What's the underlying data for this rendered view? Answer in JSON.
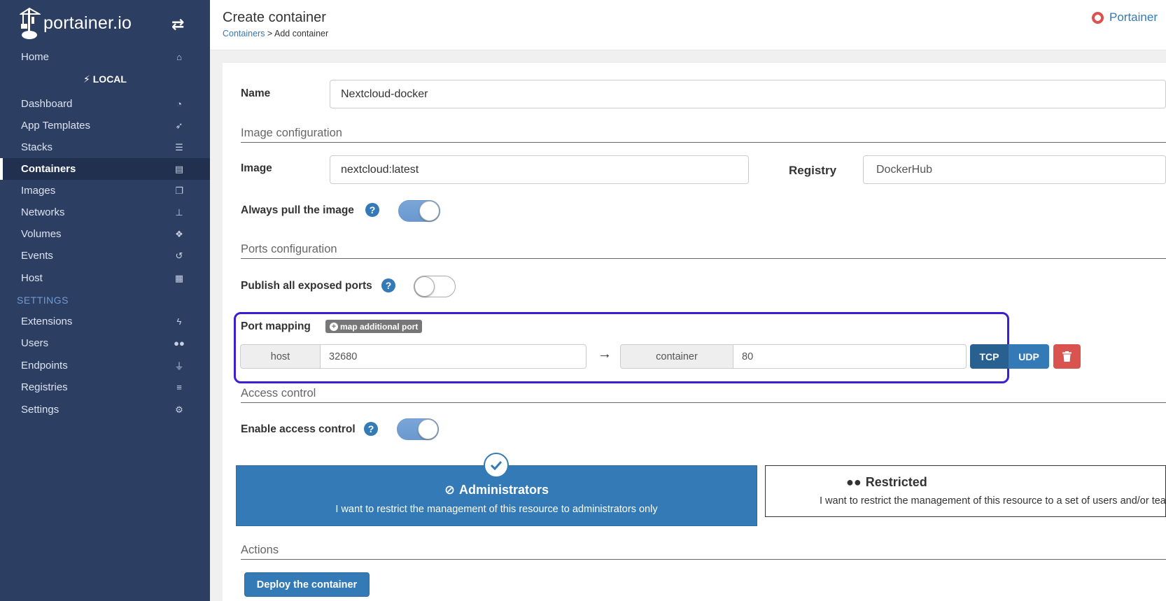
{
  "sidebar": {
    "logo_text": "portainer.io",
    "toggle_icon": "exchange-arrows-icon",
    "home": {
      "label": "Home",
      "icon": "home-icon"
    },
    "endpoint_label": "LOCAL",
    "items": [
      {
        "label": "Dashboard",
        "icon": "tachometer-icon"
      },
      {
        "label": "App Templates",
        "icon": "rocket-icon"
      },
      {
        "label": "Stacks",
        "icon": "th-list-icon"
      },
      {
        "label": "Containers",
        "icon": "server-icon",
        "active": true
      },
      {
        "label": "Images",
        "icon": "clone-icon"
      },
      {
        "label": "Networks",
        "icon": "sitemap-icon"
      },
      {
        "label": "Volumes",
        "icon": "cubes-icon"
      },
      {
        "label": "Events",
        "icon": "history-icon"
      },
      {
        "label": "Host",
        "icon": "th-icon"
      }
    ],
    "settings_heading": "SETTINGS",
    "settings_items": [
      {
        "label": "Extensions",
        "icon": "bolt-icon"
      },
      {
        "label": "Users",
        "icon": "users-icon"
      },
      {
        "label": "Endpoints",
        "icon": "plug-icon"
      },
      {
        "label": "Registries",
        "icon": "database-icon"
      },
      {
        "label": "Settings",
        "icon": "cogs-icon"
      }
    ]
  },
  "header": {
    "title": "Create container",
    "breadcrumb_link": "Containers",
    "breadcrumb_sep": " > ",
    "breadcrumb_current": "Add container",
    "right_link": "Portainer"
  },
  "form": {
    "name_label": "Name",
    "name_value": "Nextcloud-docker",
    "image_section": "Image configuration",
    "image_label": "Image",
    "image_value": "nextcloud:latest",
    "registry_label": "Registry",
    "registry_value": "DockerHub",
    "always_pull_label": "Always pull the image",
    "always_pull_on": true,
    "ports_section": "Ports configuration",
    "publish_all_label": "Publish all exposed ports",
    "publish_all_on": false,
    "port_mapping_label": "Port mapping",
    "map_additional_label": "map additional port",
    "port": {
      "host_label": "host",
      "host_value": "32680",
      "container_label": "container",
      "container_value": "80",
      "tcp_label": "TCP",
      "udp_label": "UDP",
      "selected_protocol": "TCP"
    },
    "access_section": "Access control",
    "enable_access_label": "Enable access control",
    "enable_access_on": true,
    "admin_box": {
      "title": "Administrators",
      "desc": "I want to restrict the management of this resource to administrators only",
      "selected": true
    },
    "restricted_box": {
      "title": "Restricted",
      "desc": "I want to restrict the management of this resource to a set of users and/or teams"
    },
    "actions_section": "Actions",
    "deploy_label": "Deploy the container"
  },
  "colors": {
    "sidebar_bg": "#2d3e63",
    "primary": "#337ab7",
    "danger": "#d9534f",
    "highlight": "#3b1fd6"
  }
}
